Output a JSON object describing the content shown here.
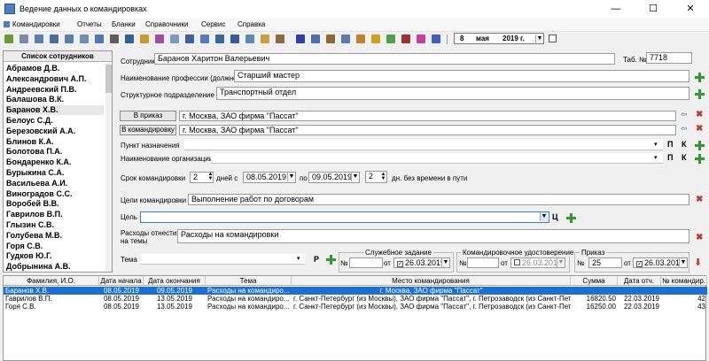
{
  "window": {
    "title": "Ведение данных о командировках",
    "minimize": "—",
    "maximize": "☐",
    "close": "✕"
  },
  "menu": [
    "Командировки",
    "Отчеты",
    "Бланки",
    "Справочники",
    "Сервис",
    "Справка"
  ],
  "toolbar_date": {
    "day": "8",
    "month": "мая",
    "year": "2019 г."
  },
  "sidebar": {
    "title": "Список сотрудников",
    "employees": [
      "Абрамов Д.В.",
      "Александрович А.П.",
      "Андреевский П.В.",
      "Балашова В.К.",
      "Баранов Х.В.",
      "Белоус С.Д.",
      "Березовский А.А.",
      "Блинов К.А.",
      "Болотова П.А.",
      "Бондаренко К.А.",
      "Бурыкина С.А.",
      "Васильева А.И.",
      "Виноградов С.С.",
      "Воробей В.В.",
      "Гаврилов В.П.",
      "Глызин С.В.",
      "Голубева М.В.",
      "Горя С.В.",
      "Гудков Ю.Г.",
      "Добрынина А.В."
    ],
    "selected": "Баранов Х.В."
  },
  "form": {
    "employee_label": "Сотрудник",
    "employee_value": "Баранов Харитон Валерьевич",
    "tab_label": "Таб. №",
    "tab_value": "7718",
    "profession_label": "Наименование профессии (должности)",
    "profession_value": "Старший мастер",
    "division_label": "Структурное подразделение",
    "division_value": "Транспортный отдел",
    "order_button": "В приказ",
    "order_value": "г. Москва, ЗАО фирма \"Пассат\"",
    "trip_button": "В командировку",
    "trip_value": "г. Москва, ЗАО фирма \"Пассат\"",
    "destination_label": "Пункт назначения",
    "org_label": "Наименование организации",
    "p_label": "П",
    "k_label": "К",
    "duration_label": "Срок командировки",
    "duration_days": "2",
    "days_from_label": "дней  с",
    "date_from": "08.05.2019",
    "to_label": "по",
    "date_to": "09.05.2019",
    "road_days": "2",
    "road_label": "дн. без времени в пути",
    "purpose_label": "Цели командировки",
    "purpose_value": "Выполнение работ по договорам",
    "goal_label": "Цель",
    "goal_c_label": "Ц",
    "expenses_label": "Расходы отнести на темы",
    "expenses_value": "Расходы на командировки",
    "theme_label": "Тема",
    "theme_r_label": "Р"
  },
  "service_task": {
    "legend": "Служебное задание",
    "num_label": "№",
    "from_label": "от",
    "date": "26.03.2019"
  },
  "certificate": {
    "legend": "Командировочное удостоверение",
    "num_label": "№",
    "from_label": "от",
    "date": "26.03.2019"
  },
  "prikaz": {
    "legend": "Приказ",
    "num_label": "№",
    "num_value": "25",
    "from_label": "от",
    "date": "26.03.2019"
  },
  "table": {
    "columns": [
      "Фамилия, И.О.",
      "Дата начала",
      "Дата окончания",
      "Тема",
      "Место командирования",
      "Сумма",
      "Дата отч.",
      "№ командир."
    ],
    "rows": [
      [
        "Баранов Х.В.",
        "08.05.2019",
        "09.05.2019",
        "Расходы на командиро...",
        "г. Москва, ЗАО фирма \"Пассат\"",
        "",
        "",
        ""
      ],
      [
        "Гаврилов В.П.",
        "08.05.2019",
        "13.05.2019",
        "Расходы на командиро...",
        "г. Санкт-Петербург (из Москвы), ЗАО фирма \"Пассат\", г. Петрозаводск (из Санкт-Петер",
        "16820.50",
        "22.03.2019",
        "42"
      ],
      [
        "Горя С.В.",
        "08.05.2019",
        "13.05.2019",
        "Расходы на командиро...",
        "г. Санкт-Петербург (из Москвы), ЗАО фирма \"Пассат\", г. Петрозаводск (из Санкт-Петер",
        "16250.00",
        "22.03.2019",
        "43"
      ]
    ]
  }
}
